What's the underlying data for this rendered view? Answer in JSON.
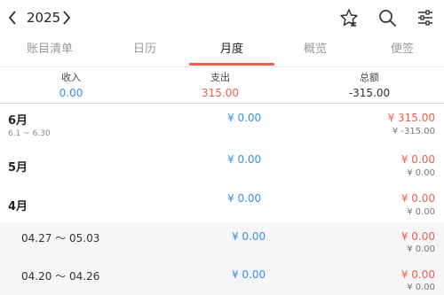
{
  "header": {
    "year": "2025"
  },
  "tabs": [
    {
      "label": "账目清单"
    },
    {
      "label": "日历"
    },
    {
      "label": "月度"
    },
    {
      "label": "概览"
    },
    {
      "label": "便签"
    }
  ],
  "summary": {
    "income_label": "收入",
    "income_value": "0.00",
    "expense_label": "支出",
    "expense_value": "315.00",
    "total_label": "总额",
    "total_value": "-315.00"
  },
  "months": [
    {
      "name": "6月",
      "range": "6.1 ~ 6.30",
      "income": "¥ 0.00",
      "expense": "¥ 315.00",
      "total": "¥ -315.00"
    },
    {
      "name": "5月",
      "income": "¥ 0.00",
      "expense": "¥ 0.00",
      "total": "¥ 0.00"
    },
    {
      "name": "4月",
      "income": "¥ 0.00",
      "expense": "¥ 0.00",
      "total": "¥ 0.00"
    }
  ],
  "weeks": [
    {
      "range": "04.27 ～ 05.03",
      "income": "¥ 0.00",
      "expense": "¥ 0.00",
      "total": "¥ 0.00"
    },
    {
      "range": "04.20 ～ 04.26",
      "income": "¥ 0.00",
      "expense": "¥ 0.00",
      "total": "¥ 0.00"
    }
  ],
  "colors": {
    "accent": "#f06050",
    "income": "#3a8ee6",
    "expense": "#f06050"
  }
}
